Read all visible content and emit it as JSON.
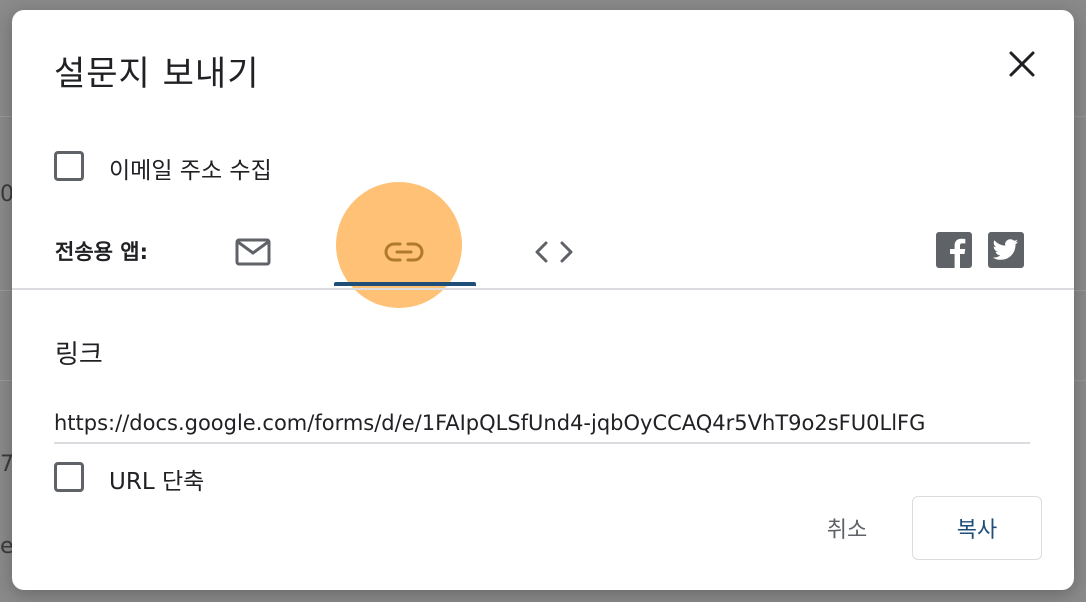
{
  "dialog": {
    "title": "설문지 보내기",
    "close_icon": "close-icon"
  },
  "collect_email": {
    "label": "이메일 주소 수집",
    "checked": false
  },
  "send_via": {
    "label": "전송용 앱:",
    "tabs": [
      {
        "name": "email",
        "icon": "mail-icon",
        "selected": false
      },
      {
        "name": "link",
        "icon": "link-icon",
        "selected": true
      },
      {
        "name": "embed",
        "icon": "code-icon",
        "selected": false
      }
    ],
    "social": [
      {
        "name": "facebook",
        "icon": "facebook-icon"
      },
      {
        "name": "twitter",
        "icon": "twitter-icon"
      }
    ]
  },
  "link_section": {
    "heading": "링크",
    "url": "https://docs.google.com/forms/d/e/1FAIpQLSfUnd4-jqbOyCCAQ4r5VhT9o2sFU0LlFG"
  },
  "shorten_url": {
    "label": "URL 단축",
    "checked": false
  },
  "actions": {
    "cancel_label": "취소",
    "copy_label": "복사"
  },
  "colors": {
    "accent": "#1f4e79",
    "highlight": "#ffb050",
    "icon": "#5f6368"
  }
}
